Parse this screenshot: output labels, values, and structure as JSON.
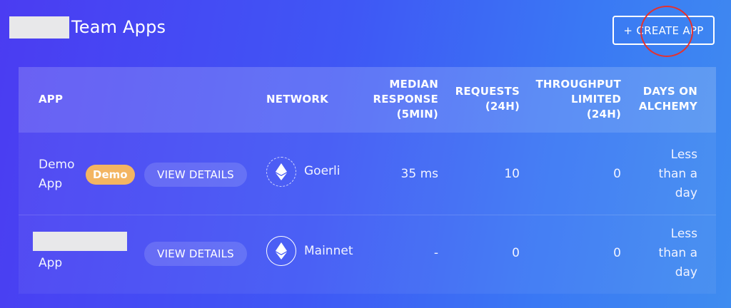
{
  "header": {
    "title": "Team Apps",
    "create_button": "+ CREATE APP"
  },
  "table": {
    "columns": {
      "app": "APP",
      "network": "NETWORK",
      "median": [
        "MEDIAN",
        "RESPONSE",
        "(5MIN)"
      ],
      "requests": [
        "REQUESTS",
        "(24H)"
      ],
      "throughput": [
        "THROUGHPUT",
        "LIMITED",
        "(24H)"
      ],
      "days": [
        "DAYS ON",
        "ALCHEMY"
      ]
    },
    "rows": [
      {
        "app_name": [
          "Demo",
          "App"
        ],
        "badge": "Demo",
        "view_details": "VIEW DETAILS",
        "network": "Goerli",
        "median": "35 ms",
        "requests": "10",
        "throughput": "0",
        "days": [
          "Less",
          "than a",
          "day"
        ]
      },
      {
        "app_name": [
          "App"
        ],
        "view_details": "VIEW DETAILS",
        "network": "Mainnet",
        "median": "-",
        "requests": "0",
        "throughput": "0",
        "days": [
          "Less",
          "than a",
          "day"
        ]
      }
    ]
  },
  "colors": {
    "badge": "#f3b562",
    "highlight": "#e5312e"
  }
}
